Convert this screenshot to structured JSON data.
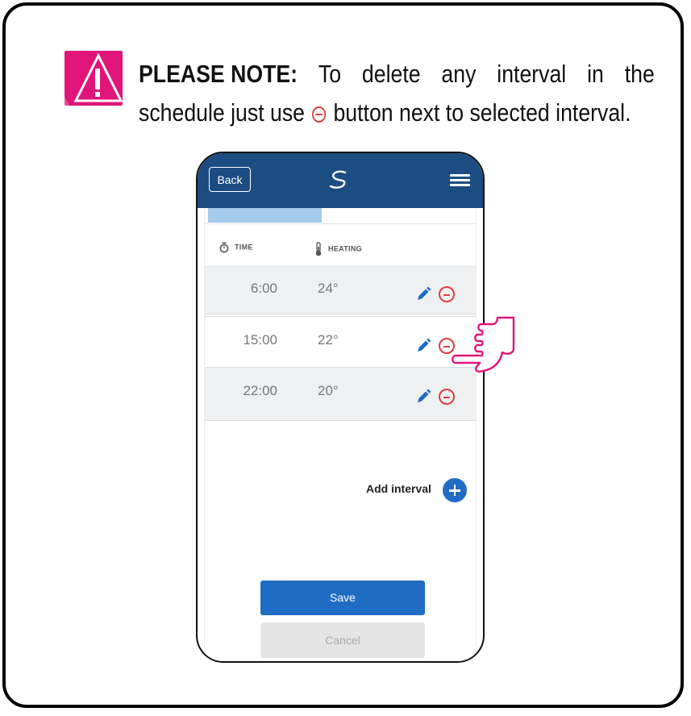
{
  "note": {
    "label": "PLEASE NOTE:",
    "line1_words": [
      "To",
      "delete",
      "any",
      "interval",
      "in",
      "the"
    ],
    "line2_before": "schedule just use",
    "line2_after": "button next to selected interval."
  },
  "header": {
    "back_label": "Back"
  },
  "progress": {
    "fraction": 0.42
  },
  "columns": {
    "time": "TIME",
    "heating": "HEATING"
  },
  "intervals": [
    {
      "time": "6:00",
      "temp": "24°"
    },
    {
      "time": "15:00",
      "temp": "22°"
    },
    {
      "time": "22:00",
      "temp": "20°"
    }
  ],
  "add_interval_label": "Add interval",
  "save_label": "Save",
  "cancel_label": "Cancel",
  "colors": {
    "accent": "#1f6cc4",
    "header": "#1c4d82",
    "delete": "#e03c3c",
    "warning": "#e0157a"
  },
  "icons": [
    "warning-icon",
    "logo-icon",
    "menu-icon",
    "timer-icon",
    "thermometer-icon",
    "edit-icon",
    "delete-icon",
    "add-icon",
    "pointing-hand-icon"
  ]
}
